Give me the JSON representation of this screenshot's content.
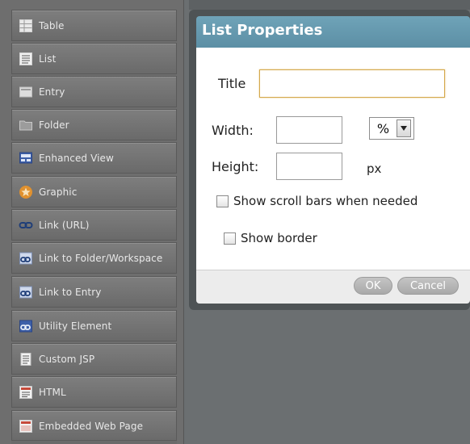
{
  "palette": {
    "items": [
      {
        "label": "Table",
        "icon": "table-icon"
      },
      {
        "label": "List",
        "icon": "list-icon"
      },
      {
        "label": "Entry",
        "icon": "entry-icon"
      },
      {
        "label": "Folder",
        "icon": "folder-icon"
      },
      {
        "label": "Enhanced View",
        "icon": "enhanced-view-icon"
      },
      {
        "label": "Graphic",
        "icon": "graphic-icon"
      },
      {
        "label": "Link (URL)",
        "icon": "link-icon"
      },
      {
        "label": "Link to Folder/Workspace",
        "icon": "link-folder-icon"
      },
      {
        "label": "Link to Entry",
        "icon": "link-entry-icon"
      },
      {
        "label": "Utility Element",
        "icon": "utility-element-icon"
      },
      {
        "label": "Custom JSP",
        "icon": "custom-jsp-icon"
      },
      {
        "label": "HTML",
        "icon": "html-icon"
      },
      {
        "label": "Embedded Web Page",
        "icon": "embedded-web-page-icon"
      }
    ]
  },
  "dialog": {
    "title": "List Properties",
    "title_label": "Title",
    "title_value": "",
    "width_label": "Width:",
    "width_value": "",
    "width_unit": "%",
    "height_label": "Height:",
    "height_value": "",
    "height_unit": "px",
    "scroll_label": "Show scroll bars when needed",
    "border_label": "Show border",
    "ok_label": "OK",
    "cancel_label": "Cancel"
  },
  "colors": {
    "header": "#6fa3b8",
    "palette_bg": "#6e6e6e",
    "workspace_bg": "#6b6f71",
    "title_focus_border": "#d4a84a"
  }
}
